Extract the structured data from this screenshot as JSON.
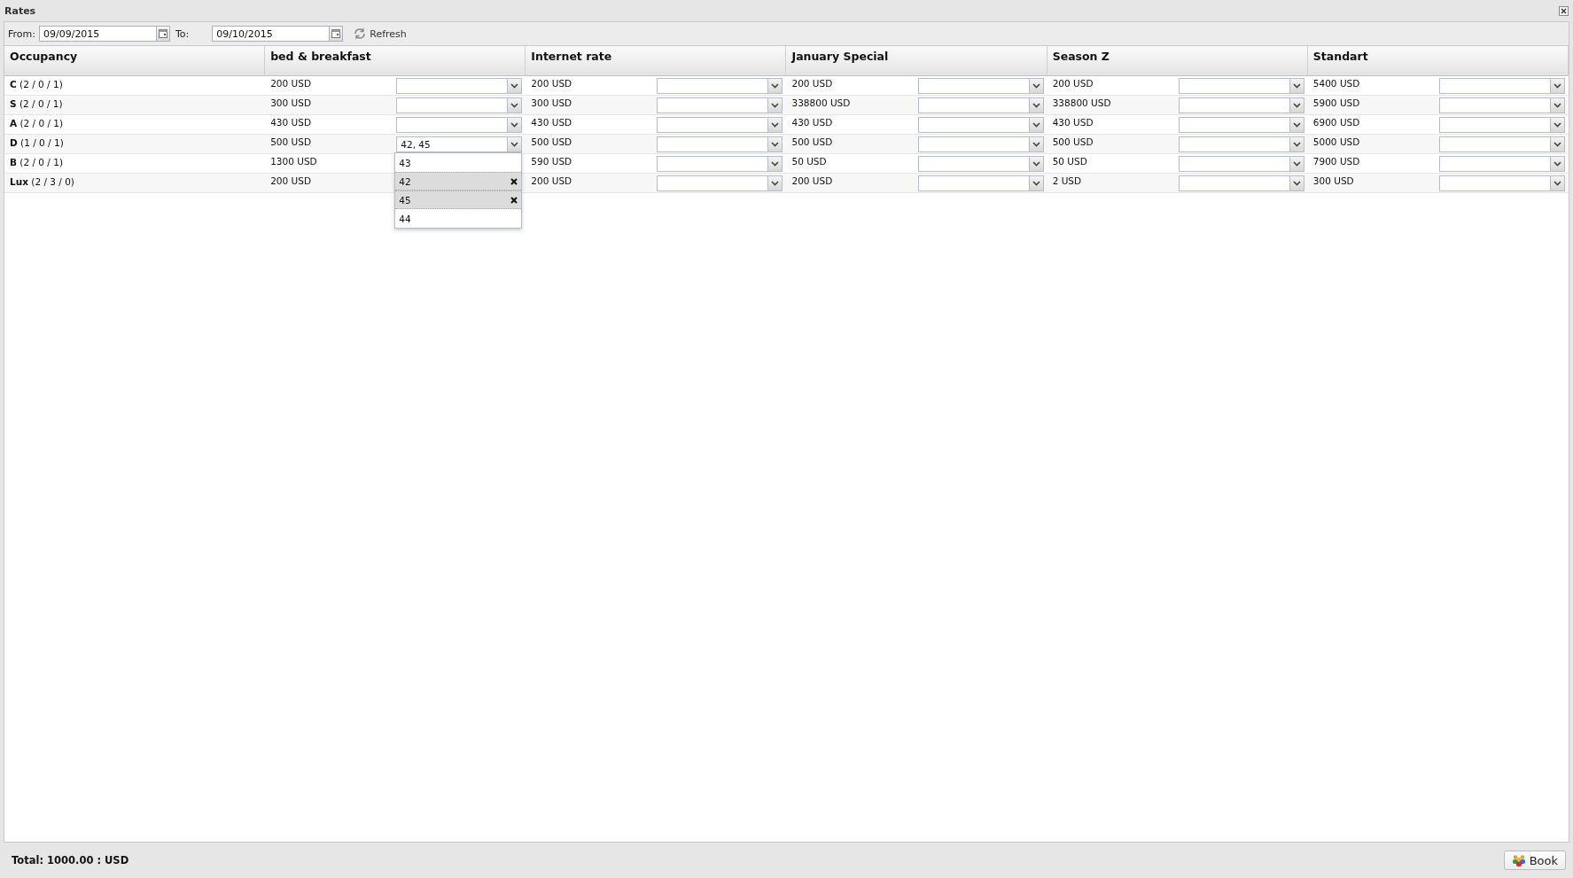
{
  "window": {
    "title": "Rates"
  },
  "toolbar": {
    "from_label": "From:",
    "from_value": "09/09/2015",
    "to_label": "To:",
    "to_value": "09/10/2015",
    "refresh": "Refresh"
  },
  "table": {
    "columns": [
      "Occupancy",
      "bed & breakfast",
      "Internet rate",
      "January Special",
      "Season Z",
      "Standart"
    ],
    "rows": [
      {
        "cells": [
          {
            "code": "C",
            "detail": "(2 / 0 / 1)"
          },
          {
            "price": "200 USD",
            "picker": true
          },
          {
            "price": "200 USD",
            "picker": true
          },
          {
            "price": "200 USD",
            "picker": true
          },
          {
            "price": "200 USD",
            "picker": true
          },
          {
            "price": "5400 USD",
            "picker": true
          }
        ]
      },
      {
        "cells": [
          {
            "code": "S",
            "detail": "(2 / 0 / 1)"
          },
          {
            "price": "300 USD",
            "picker": true
          },
          {
            "price": "300 USD",
            "picker": true
          },
          {
            "price": "338800 USD",
            "picker": true
          },
          {
            "price": "338800 USD",
            "picker": true
          },
          {
            "price": "5900 USD",
            "picker": true
          }
        ]
      },
      {
        "cells": [
          {
            "code": "A",
            "detail": "(2 / 0 / 1)"
          },
          {
            "price": "430 USD",
            "picker": true
          },
          {
            "price": "430 USD",
            "picker": true
          },
          {
            "price": "430 USD",
            "picker": true
          },
          {
            "price": "430 USD",
            "picker": true
          },
          {
            "price": "6900 USD",
            "picker": true
          }
        ]
      },
      {
        "cells": [
          {
            "code": "D",
            "detail": "(1 / 0 / 1)"
          },
          {
            "price": "500 USD",
            "picker": true,
            "value": "42, 45",
            "options": [
              {
                "label": "43",
                "selected": false
              },
              {
                "label": "42",
                "selected": true
              },
              {
                "label": "45",
                "selected": true
              },
              {
                "label": "44",
                "selected": false
              }
            ]
          },
          {
            "price": "500 USD",
            "picker": true
          },
          {
            "price": "500 USD",
            "picker": true
          },
          {
            "price": "500 USD",
            "picker": true
          },
          {
            "price": "5000 USD",
            "picker": true
          }
        ]
      },
      {
        "cells": [
          {
            "code": "B",
            "detail": "(2 / 0 / 1)"
          },
          {
            "price": "1300 USD",
            "picker": false
          },
          {
            "price": "590 USD",
            "picker": true
          },
          {
            "price": "50 USD",
            "picker": true
          },
          {
            "price": "50 USD",
            "picker": true
          },
          {
            "price": "7900 USD",
            "picker": true
          }
        ]
      },
      {
        "cells": [
          {
            "code": "Lux",
            "detail": "(2 / 3 / 0)"
          },
          {
            "price": "200 USD",
            "picker": false
          },
          {
            "price": "200 USD",
            "picker": true
          },
          {
            "price": "200 USD",
            "picker": true
          },
          {
            "price": "2 USD",
            "picker": true
          },
          {
            "price": "300 USD",
            "picker": true
          }
        ]
      }
    ]
  },
  "footer": {
    "total": "Total: 1000.00 : USD",
    "book": "Book"
  }
}
